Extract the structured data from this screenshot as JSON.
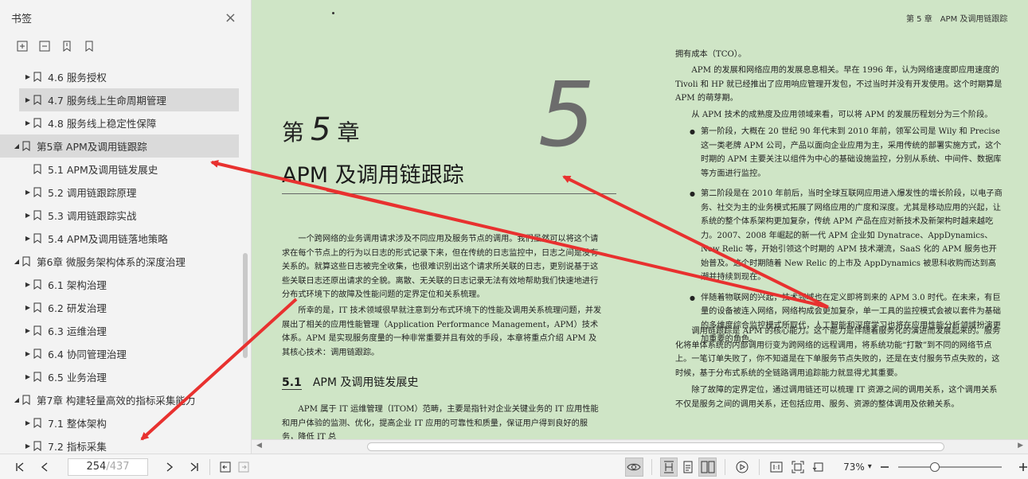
{
  "sidebar": {
    "title": "书签",
    "close_icon": "×",
    "tools": [
      "add-bookmark-icon",
      "remove-bookmark-icon",
      "bookmark-icon",
      "bookmark-outline-icon"
    ],
    "items": [
      {
        "label": "4.6 服务授权",
        "level": 2,
        "caret": "right"
      },
      {
        "label": "4.7 服务线上生命周期管理",
        "level": 2,
        "caret": "right",
        "selected": true
      },
      {
        "label": "4.8 服务线上稳定性保障",
        "level": 2,
        "caret": "right"
      },
      {
        "label": "第5章 APM及调用链跟踪",
        "level": 1,
        "caret": "down",
        "selected": true
      },
      {
        "label": "5.1 APM及调用链发展史",
        "level": 2,
        "caret": "none"
      },
      {
        "label": "5.2 调用链跟踪原理",
        "level": 2,
        "caret": "right"
      },
      {
        "label": "5.3 调用链跟踪实战",
        "level": 2,
        "caret": "right"
      },
      {
        "label": "5.4 APM及调用链落地策略",
        "level": 2,
        "caret": "right"
      },
      {
        "label": "第6章 微服务架构体系的深度治理",
        "level": 1,
        "caret": "down"
      },
      {
        "label": "6.1 架构治理",
        "level": 2,
        "caret": "right"
      },
      {
        "label": "6.2 研发治理",
        "level": 2,
        "caret": "right"
      },
      {
        "label": "6.3 运维治理",
        "level": 2,
        "caret": "right"
      },
      {
        "label": "6.4 协同管理治理",
        "level": 2,
        "caret": "right"
      },
      {
        "label": "6.5 业务治理",
        "level": 2,
        "caret": "right"
      },
      {
        "label": "第7章 构建轻量高效的指标采集能力",
        "level": 1,
        "caret": "down"
      },
      {
        "label": "7.1 整体架构",
        "level": 2,
        "caret": "right"
      },
      {
        "label": "7.2 指标采集",
        "level": 2,
        "caret": "right"
      }
    ]
  },
  "document": {
    "running_header": "第 5 章　APM 及调用链跟踪",
    "big_number": "5",
    "chapter_prefix": "第",
    "chapter_num": "5",
    "chapter_suffix": "章",
    "chapter_title": "APM 及调用链跟踪",
    "intro_p1": "一个跨网络的业务调用请求涉及不同应用及服务节点的调用。我们虽然可以将这个请求在每个节点上的行为以日志的形式记录下来，但在传统的日志监控中，日志之间是没有关系的。就算这些日志被完全收集，也很难识别出这个请求所关联的日志，更别说基于这些关联日志还原出请求的全貌。离散、无关联的日志记录无法有效地帮助我们快速地进行分布式环境下的故障及性能问题的定界定位和关系梳理。",
    "intro_p2": "所幸的是，IT 技术领域很早就注意到分布式环境下的性能及调用关系梳理问题，并发展出了相关的应用性能管理（Application Performance Management，APM）技术体系。APM 是实现服务度量的一种非常重要并且有效的手段，本章将重点介绍 APM 及其核心技术：调用链跟踪。",
    "section_num": "5.1",
    "section_title": "APM 及调用链发展史",
    "sec_p1": "APM 属于 IT 运维管理（ITOM）范畴，主要是指针对企业关键业务的 IT 应用性能和用户体验的监测、优化，提高企业 IT 应用的可靠性和质量，保证用户得到良好的服务，降低 IT 总",
    "right_p0": "拥有成本（TCO）。",
    "right_p1": "APM 的发展和网络应用的发展息息相关。早在 1996 年，认为网络速度即应用速度的 Tivoli 和 HP 就已经推出了应用响应管理开发包，不过当时并没有开发使用。这个时期算是 APM 的萌芽期。",
    "right_p2": "从 APM 技术的成熟度及应用领域来看，可以将 APM 的发展历程划分为三个阶段。",
    "bullet1": "第一阶段，大概在 20 世纪 90 年代末到 2010 年前，领军公司是 Wily 和 Precise 这一类老牌 APM 公司，产品以面向企业应用为主，采用传统的部署实施方式，这个时期的 APM 主要关注以组件为中心的基础设施监控，分别从系统、中间件、数据库等方面进行监控。",
    "bullet2": "第二阶段是在 2010 年前后，当时全球互联网应用进入爆发性的增长阶段，以电子商务、社交为主的业务模式拓展了网络应用的广度和深度。尤其是移动应用的兴起，让系统的整个体系架构更加复杂，传统 APM 产品在应对新技术及新架构时越来越吃力。2007、2008 年崛起的新一代 APM 企业如 Dynatrace、AppDynamics、New Relic 等，开始引领这个时期的 APM 技术潮流，SaaS 化的 APM 服务也开始普及。这个时期随着 New Relic 的上市及 AppDynamics 被思科收购而达到高潮并持续到现在。",
    "bullet3": "伴随着物联网的兴起，技术领域也在定义即将到来的 APM 3.0 时代。在未来，有巨量的设备被连入网络，网络构成会更加复杂，单一工具的监控模式会被以套件为基础的多维度综合监控模式所取代，人工智能和深度学习也将在应用性能分析领域扮演更加重要的角色。",
    "right_p3": "调用链跟踪是 APM 的核心能力。这个能力是伴随着服务化的演进而发展起来的。服务化将单体系统的内部调用衍变为跨网络的远程调用，将系统功能“打散”到不同的网络节点上。一笔订单失败了，你不知道是在下单服务节点失败的，还是在支付服务节点失败的，这时候，基于分布式系统的全链路调用追踪能力就显得尤其重要。",
    "right_p4": "除了故障的定界定位，通过调用链还可以梳理 IT 资源之间的调用关系，这个调用关系不仅是服务之间的调用关系，还包括应用、服务、资源的整体调用及依赖关系。"
  },
  "statusbar": {
    "current_page": "254",
    "total_pages": "/437",
    "zoom": "73%",
    "zoom_fraction": 0.33
  },
  "colors": {
    "page_bg": "#cfe5c6",
    "sidebar_bg": "#f3f3f3",
    "annotation_red": "#e8312f"
  }
}
